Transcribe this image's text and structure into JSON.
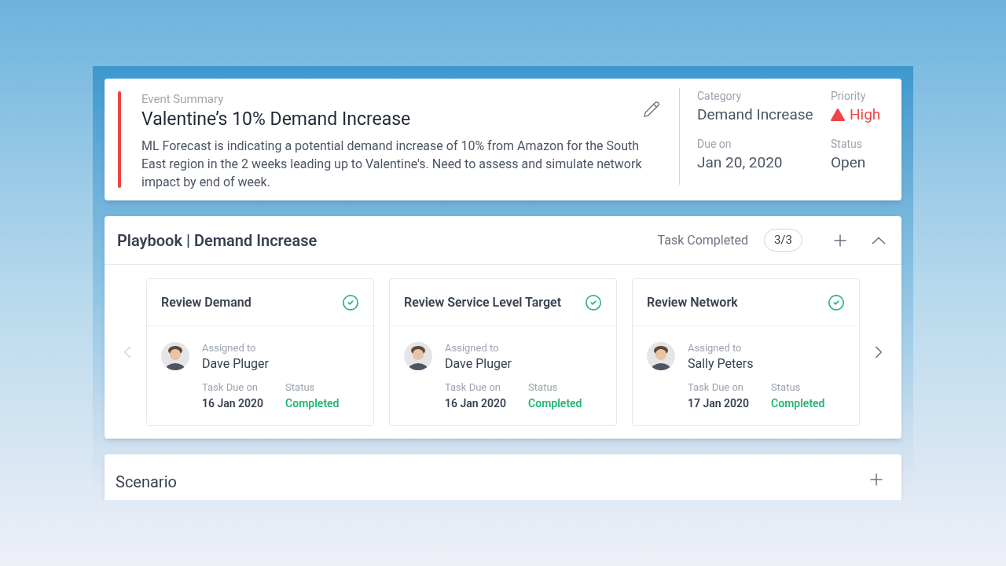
{
  "event": {
    "label": "Event Summary",
    "title": "Valentine’s 10% Demand Increase",
    "description": "ML Forecast is indicating a potential demand increase of 10% from Amazon for the South East region in the 2 weeks leading up to Valentine's. Need to assess and simulate network impact by end of week.",
    "color": "#ef4444",
    "fields": [
      {
        "label": "Category",
        "value": "Demand Increase",
        "kind": "plain"
      },
      {
        "label": "Priority",
        "value": "High",
        "kind": "priority"
      },
      {
        "label": "Due on",
        "value": "Jan 20, 2020",
        "kind": "plain"
      },
      {
        "label": "Status",
        "value": "Open",
        "kind": "plain"
      }
    ]
  },
  "playbook": {
    "title": "Playbook | Demand Increase",
    "progress_label": "Task Completed",
    "progress": "3/3",
    "expanded": true,
    "tasks": [
      {
        "title": "Review Demand",
        "completed": true,
        "assigned_label": "Assigned to",
        "assignee": "Dave Pluger",
        "due_label": "Task Due on",
        "due": "16 Jan 2020",
        "status_label": "Status",
        "status": "Completed"
      },
      {
        "title": "Review Service Level Target",
        "completed": true,
        "assigned_label": "Assigned to",
        "assignee": "Dave Pluger",
        "due_label": "Task Due on",
        "due": "16 Jan 2020",
        "status_label": "Status",
        "status": "Completed"
      },
      {
        "title": "Review Network",
        "completed": true,
        "assigned_label": "Assigned to",
        "assignee": "Sally Peters",
        "due_label": "Task Due on",
        "due": "17 Jan 2020",
        "status_label": "Status",
        "status": "Completed"
      }
    ]
  },
  "scenario": {
    "title": "Scenario"
  }
}
